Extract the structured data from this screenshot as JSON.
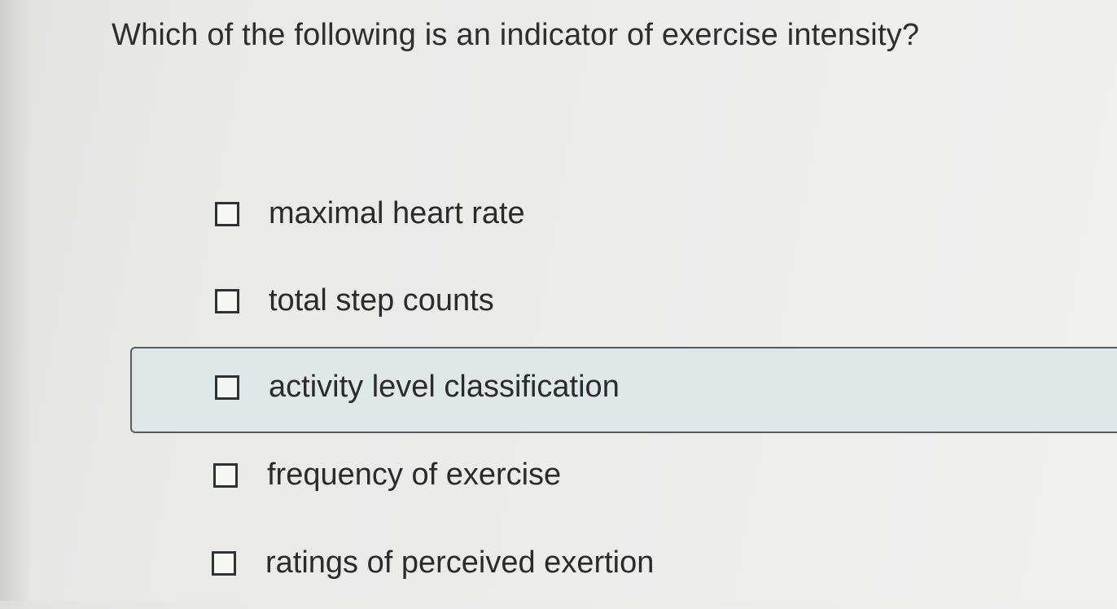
{
  "question": {
    "text": "Which of the following is an indicator of exercise intensity?"
  },
  "options": [
    {
      "label": "maximal heart rate",
      "checked": false,
      "highlighted": false
    },
    {
      "label": "total step counts",
      "checked": false,
      "highlighted": false
    },
    {
      "label": "activity level classification",
      "checked": false,
      "highlighted": true
    },
    {
      "label": "frequency of exercise",
      "checked": false,
      "highlighted": false
    },
    {
      "label": "ratings of perceived exertion",
      "checked": false,
      "highlighted": false
    }
  ],
  "colors": {
    "highlight_background": "#dfe7e8",
    "highlight_border": "#585b5c",
    "text": "#2b2b2b",
    "page_background": "#ebebea"
  }
}
